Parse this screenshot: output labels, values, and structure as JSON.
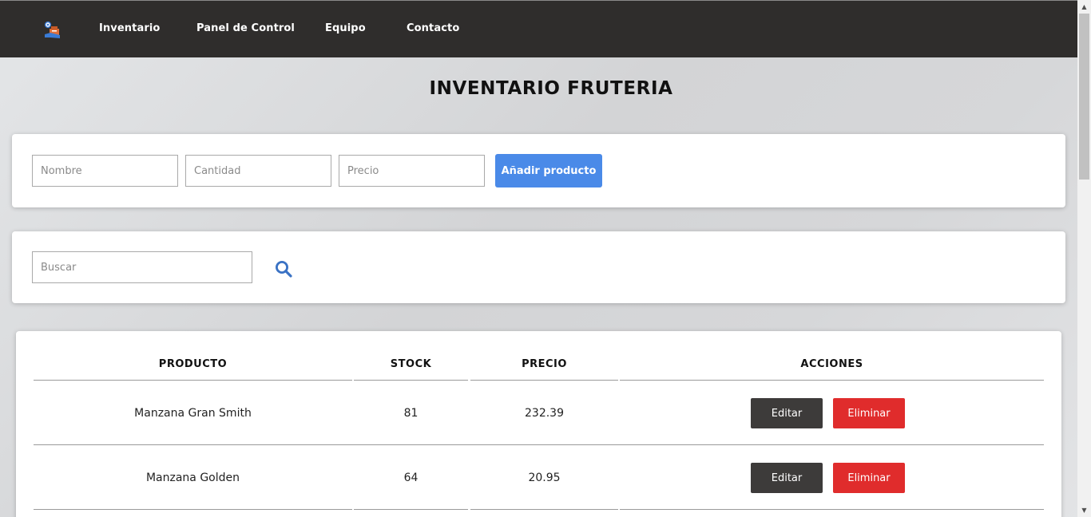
{
  "navbar": {
    "logo_icon": "inventory-box-icon",
    "links": [
      "Inventario",
      "Panel de Control",
      "Equipo",
      "Contacto"
    ]
  },
  "page_title": "INVENTARIO FRUTERIA",
  "add_form": {
    "name_placeholder": "Nombre",
    "quantity_placeholder": "Cantidad",
    "price_placeholder": "Precio",
    "add_button": "Añadir producto"
  },
  "search": {
    "placeholder": "Buscar",
    "icon": "search-icon"
  },
  "table": {
    "headers": [
      "PRODUCTO",
      "STOCK",
      "PRECIO",
      "ACCIONES"
    ],
    "rows": [
      {
        "product": "Manzana Gran Smith",
        "stock": "81",
        "price": "232.39"
      },
      {
        "product": "Manzana Golden",
        "stock": "64",
        "price": "20.95"
      }
    ],
    "edit_label": "Editar",
    "delete_label": "Eliminar"
  },
  "colors": {
    "navbar": "#2f2d2c",
    "primary_button": "#4a8ae8",
    "edit_button": "#3d3b3a",
    "delete_button": "#e02c2c"
  }
}
